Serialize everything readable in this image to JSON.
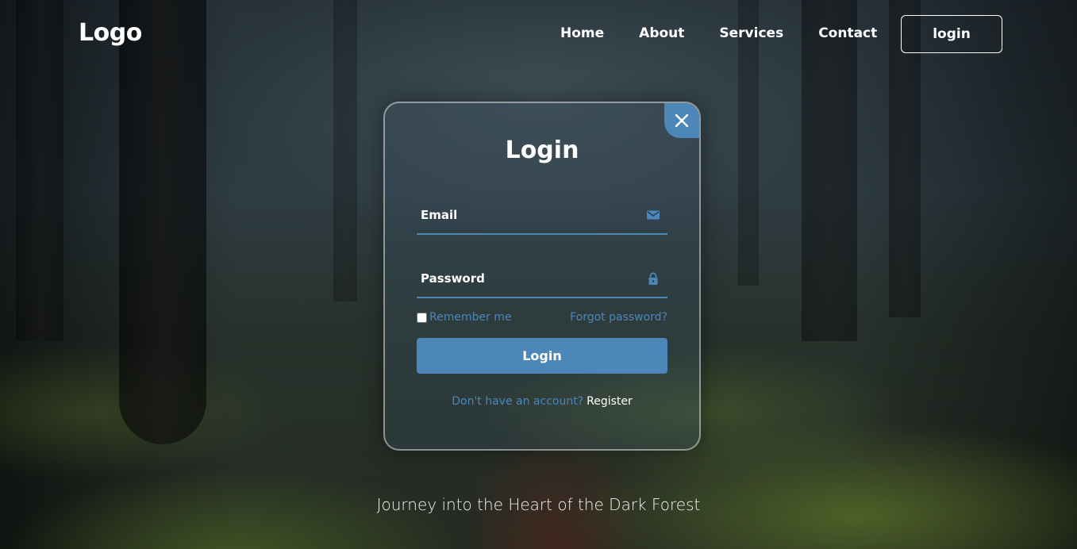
{
  "header": {
    "logo": "Logo",
    "nav": [
      "Home",
      "About",
      "Services",
      "Contact"
    ],
    "login_button": "login"
  },
  "login_form": {
    "title": "Login",
    "email_placeholder": "Email",
    "password_placeholder": "Password",
    "remember_label": "Remember me",
    "forgot_label": "Forgot password?",
    "submit_label": "Login",
    "no_account_text": "Don't have an account?",
    "register_label": "Register",
    "icons": {
      "close": "close-icon",
      "email": "mail-icon",
      "password": "lock-icon"
    }
  },
  "tagline": "Journey into the Heart of the Dark Forest",
  "colors": {
    "accent": "#4d86b8",
    "text": "#ffffff"
  }
}
